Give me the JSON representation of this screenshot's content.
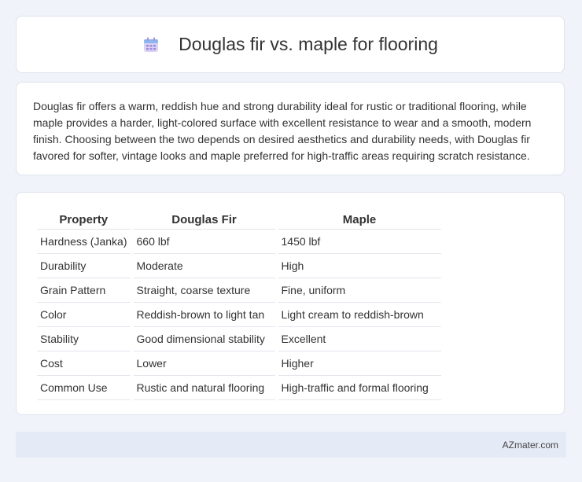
{
  "header": {
    "icon": "calendar-icon",
    "title": "Douglas fir vs. maple for flooring"
  },
  "summary": {
    "text": "Douglas fir offers a warm, reddish hue and strong durability ideal for rustic or traditional flooring, while maple provides a harder, light-colored surface with excellent resistance to wear and a smooth, modern finish. Choosing between the two depends on desired aesthetics and durability needs, with Douglas fir favored for softer, vintage looks and maple preferred for high-traffic areas requiring scratch resistance."
  },
  "table": {
    "headers": [
      "Property",
      "Douglas Fir",
      "Maple"
    ],
    "rows": [
      [
        "Hardness (Janka)",
        "660 lbf",
        "1450 lbf"
      ],
      [
        "Durability",
        "Moderate",
        "High"
      ],
      [
        "Grain Pattern",
        "Straight, coarse texture",
        "Fine, uniform"
      ],
      [
        "Color",
        "Reddish-brown to light tan",
        "Light cream to reddish-brown"
      ],
      [
        "Stability",
        "Good dimensional stability",
        "Excellent"
      ],
      [
        "Cost",
        "Lower",
        "Higher"
      ],
      [
        "Common Use",
        "Rustic and natural flooring",
        "High-traffic and formal flooring"
      ]
    ]
  },
  "footer": {
    "brand": "AZmater.com"
  }
}
